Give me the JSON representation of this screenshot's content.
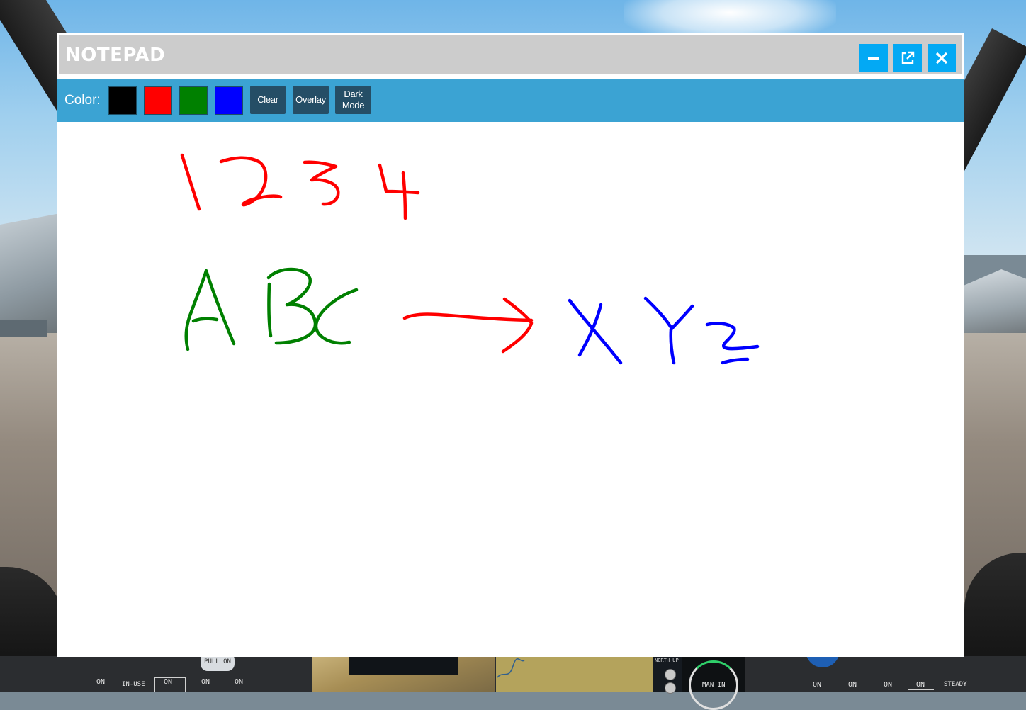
{
  "notepad": {
    "title": "NOTEPAD",
    "toolbar": {
      "color_label": "Color:",
      "colors": [
        {
          "name": "black",
          "hex": "#000000"
        },
        {
          "name": "red",
          "hex": "#ff0000"
        },
        {
          "name": "green",
          "hex": "#008000"
        },
        {
          "name": "blue",
          "hex": "#0000ff"
        }
      ],
      "clear_label": "Clear",
      "overlay_label": "Overlay",
      "dark_mode_label_line1": "Dark",
      "dark_mode_label_line2": "Mode"
    },
    "window_buttons": [
      "minimize-icon",
      "popout-icon",
      "close-icon"
    ],
    "ink": {
      "red": "#ff0000",
      "green": "#008000",
      "blue": "#0000ff"
    }
  },
  "cockpit": {
    "pull_on": "PULL ON",
    "switch_labels": [
      "ON",
      "IN-USE",
      "ON",
      "ON",
      "ON"
    ],
    "north_up": "NORTH UP",
    "man_in": "MAN IN",
    "right_labels": [
      "ON",
      "ON",
      "ON",
      "ON",
      "STEADY"
    ]
  }
}
